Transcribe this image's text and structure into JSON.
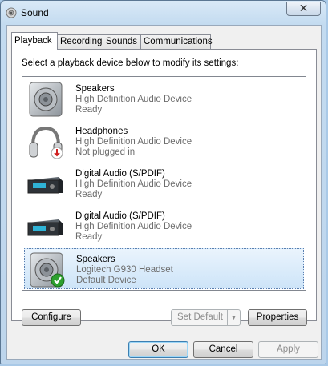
{
  "window": {
    "title": "Sound",
    "close_label": "✕"
  },
  "tabs": [
    {
      "label": "Playback",
      "active": true
    },
    {
      "label": "Recording",
      "active": false
    },
    {
      "label": "Sounds",
      "active": false
    },
    {
      "label": "Communications",
      "active": false
    }
  ],
  "panel": {
    "instruction": "Select a playback device below to modify its settings:"
  },
  "devices": [
    {
      "name": "Speakers",
      "description": "High Definition Audio Device",
      "status": "Ready",
      "icon": "speaker-icon",
      "selected": false
    },
    {
      "name": "Headphones",
      "description": "High Definition Audio Device",
      "status": "Not plugged in",
      "icon": "headphones-icon",
      "selected": false
    },
    {
      "name": "Digital Audio (S/PDIF)",
      "description": "High Definition Audio Device",
      "status": "Ready",
      "icon": "digital-audio-icon",
      "selected": false
    },
    {
      "name": "Digital Audio (S/PDIF)",
      "description": "High Definition Audio Device",
      "status": "Ready",
      "icon": "digital-audio-icon",
      "selected": false
    },
    {
      "name": "Speakers",
      "description": "Logitech G930 Headset",
      "status": "Default Device",
      "icon": "speaker-icon",
      "selected": true
    }
  ],
  "panel_buttons": {
    "configure": "Configure",
    "set_default": "Set Default",
    "set_default_arrow": "▼",
    "properties": "Properties"
  },
  "dialog_buttons": {
    "ok": "OK",
    "cancel": "Cancel",
    "apply": "Apply"
  }
}
